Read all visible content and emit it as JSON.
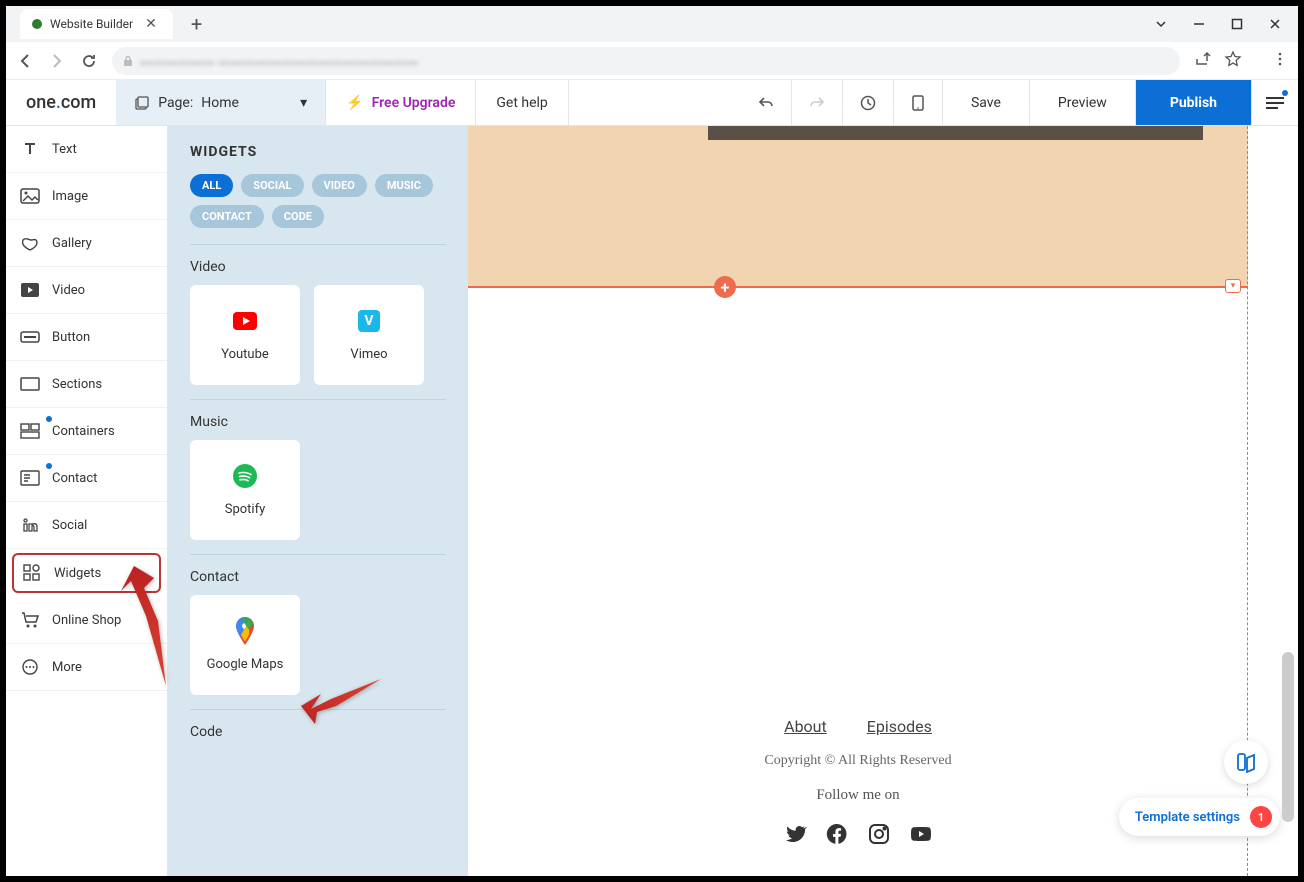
{
  "browser": {
    "tab_title": "Website Builder",
    "url_blur": "▬▬▬▬▬▬   ▬▬▬▬▬▬▬▬▬▬▬▬▬▬▬▬"
  },
  "logo": {
    "part1": "one",
    "part2": ".",
    "part3": "com"
  },
  "page_selector": {
    "label": "Page:",
    "value": "Home"
  },
  "toolbar": {
    "upgrade": "Free Upgrade",
    "help": "Get help",
    "save": "Save",
    "preview": "Preview",
    "publish": "Publish"
  },
  "sidebar": {
    "items": [
      {
        "label": "Text",
        "icon": "text"
      },
      {
        "label": "Image",
        "icon": "image"
      },
      {
        "label": "Gallery",
        "icon": "gallery"
      },
      {
        "label": "Video",
        "icon": "video"
      },
      {
        "label": "Button",
        "icon": "button"
      },
      {
        "label": "Sections",
        "icon": "sections"
      },
      {
        "label": "Containers",
        "icon": "containers"
      },
      {
        "label": "Contact",
        "icon": "contact"
      },
      {
        "label": "Social",
        "icon": "social"
      },
      {
        "label": "Widgets",
        "icon": "widgets"
      },
      {
        "label": "Online Shop",
        "icon": "shop"
      },
      {
        "label": "More",
        "icon": "more"
      }
    ]
  },
  "widgets_panel": {
    "title": "WIDGETS",
    "filters": [
      "ALL",
      "SOCIAL",
      "VIDEO",
      "MUSIC",
      "CONTACT",
      "CODE"
    ],
    "sections": {
      "video": {
        "label": "Video",
        "items": [
          "Youtube",
          "Vimeo"
        ]
      },
      "music": {
        "label": "Music",
        "items": [
          "Spotify"
        ]
      },
      "contact": {
        "label": "Contact",
        "items": [
          "Google Maps"
        ]
      },
      "code": {
        "label": "Code"
      }
    }
  },
  "canvas": {
    "footer_links": [
      "About",
      "Episodes"
    ],
    "copyright": "Copyright © All Rights Reserved",
    "follow": "Follow me on"
  },
  "template_settings": {
    "label": "Template settings",
    "badge": "1"
  }
}
